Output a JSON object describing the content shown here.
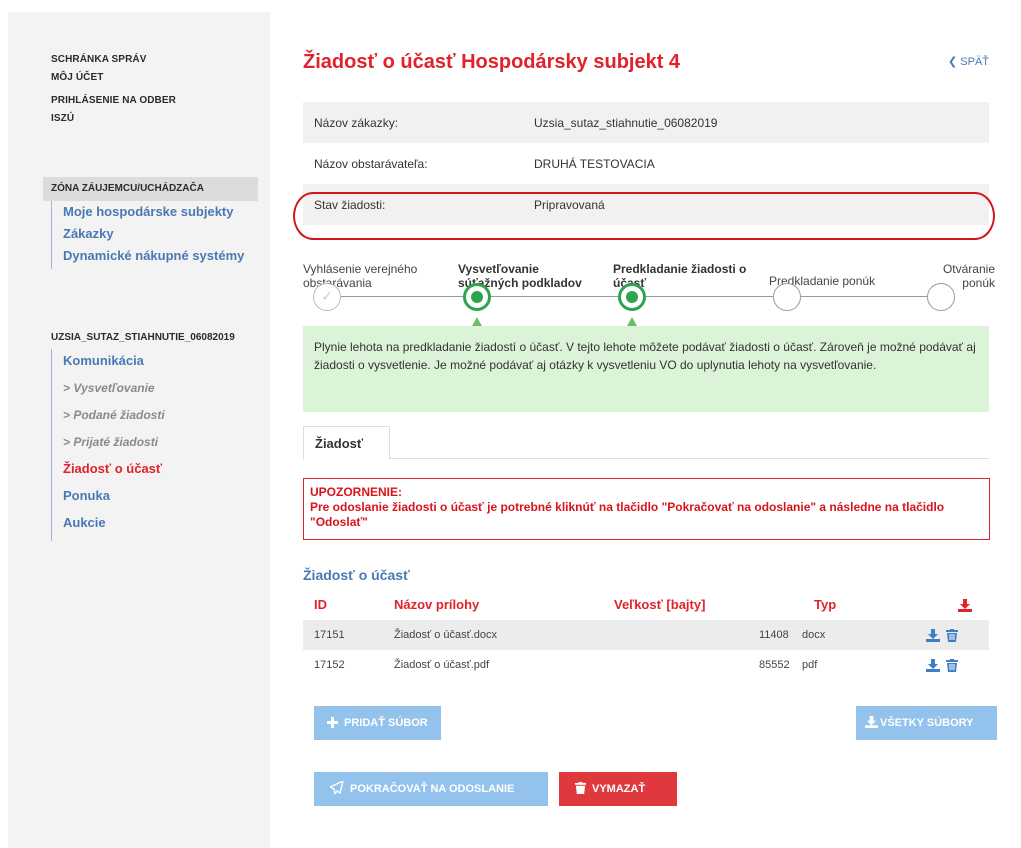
{
  "sidebar": {
    "top_links": [
      "SCHRÁNKA SPRÁV",
      "MÔJ ÚČET",
      "PRIHLÁSENIE NA ODBER",
      "ISZÚ"
    ],
    "zone_title": "ZÓNA ZÁUJEMCU/UCHÁDZAČA",
    "zone_items": [
      "Moje hospodárske subjekty",
      "Zákazky",
      "Dynamické nákupné systémy"
    ],
    "project_title": "UZSIA_SUTAZ_STIAHNUTIE_06082019",
    "project_items": [
      "Komunikácia",
      "> Vysvetľovanie",
      "> Podané žiadosti",
      "> Prijaté žiadosti",
      "Žiadosť o účasť",
      "Ponuka",
      "Aukcie"
    ]
  },
  "page": {
    "title": "Žiadosť o účasť Hospodársky subjekt 4",
    "back_label": "SPÄŤ"
  },
  "info": [
    {
      "label": "Názov zákazky:",
      "value": "Uzsia_sutaz_stiahnutie_06082019"
    },
    {
      "label": "Názov obstarávateľa:",
      "value": "DRUHÁ TESTOVACIA"
    },
    {
      "label": "Stav žiadosti:",
      "value": "Pripravovaná"
    }
  ],
  "steps": [
    {
      "label": "Vyhlásenie verejného obstarávania",
      "state": "done"
    },
    {
      "label": "Vysvetľovanie súťažných podkladov",
      "state": "active"
    },
    {
      "label": "Predkladanie žiadosti o účasť",
      "state": "active"
    },
    {
      "label": "Predkladanie ponúk",
      "state": "pending"
    },
    {
      "label": "Otváranie ponúk",
      "state": "pending"
    }
  ],
  "notice": "Plynie lehota na predkladanie žiadostí o účasť. V tejto lehote môžete podávať žiadosti o účasť. Zároveň je možné podávať aj žiadosti o vysvetlenie. Je možné podávať aj otázky k vysvetleniu VO do uplynutia lehoty na vysvetľovanie.",
  "tab_label": "Žiadosť",
  "warning": {
    "title": "UPOZORNENIE:",
    "text": "Pre odoslanie žiadosti o účasť je potrebné kliknúť na tlačidlo \"Pokračovať na odoslanie\" a následne na tlačidlo \"Odoslať\""
  },
  "section_title": "Žiadosť o účasť",
  "table": {
    "headers": {
      "id": "ID",
      "name": "Názov prílohy",
      "size": "Veľkosť [bajty]",
      "type": "Typ"
    },
    "rows": [
      {
        "id": "17151",
        "name": "Žiadosť o účasť.docx",
        "size": "11408",
        "type": "docx"
      },
      {
        "id": "17152",
        "name": "Žiadosť o účasť.pdf",
        "size": "85552",
        "type": "pdf"
      }
    ]
  },
  "buttons": {
    "add_file": "PRIDAŤ SÚBOR",
    "all_files": "VŠETKY SÚBORY",
    "continue": "POKRAČOVAŤ NA ODOSLANIE",
    "delete": "VYMAZAŤ"
  },
  "colors": {
    "accent_red": "#e1222a",
    "link_blue": "#4a78b5",
    "button_blue": "#93c3ec",
    "button_red": "#e0393d",
    "active_green": "#2ea44f"
  }
}
